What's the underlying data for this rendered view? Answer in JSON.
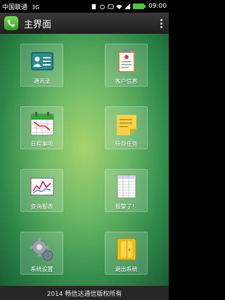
{
  "status_bar": {
    "carrier": "中国联通",
    "network": "3G",
    "time": "09:00"
  },
  "title_bar": {
    "title": "主界面"
  },
  "tiles": [
    {
      "label": "通讯录",
      "icon": "contact-card-icon"
    },
    {
      "label": "客户信息",
      "icon": "clipboard-icon"
    },
    {
      "label": "日程事项",
      "icon": "calendar-icon"
    },
    {
      "label": "待办任务",
      "icon": "sticky-note-icon"
    },
    {
      "label": "查询报表",
      "icon": "report-chart-icon"
    },
    {
      "label": "报警了！",
      "icon": "spreadsheet-icon"
    },
    {
      "label": "系统设置",
      "icon": "gears-icon"
    },
    {
      "label": "退出系统",
      "icon": "exit-door-icon"
    }
  ],
  "footer": {
    "text": "2014 畅信达通信版权所有"
  }
}
